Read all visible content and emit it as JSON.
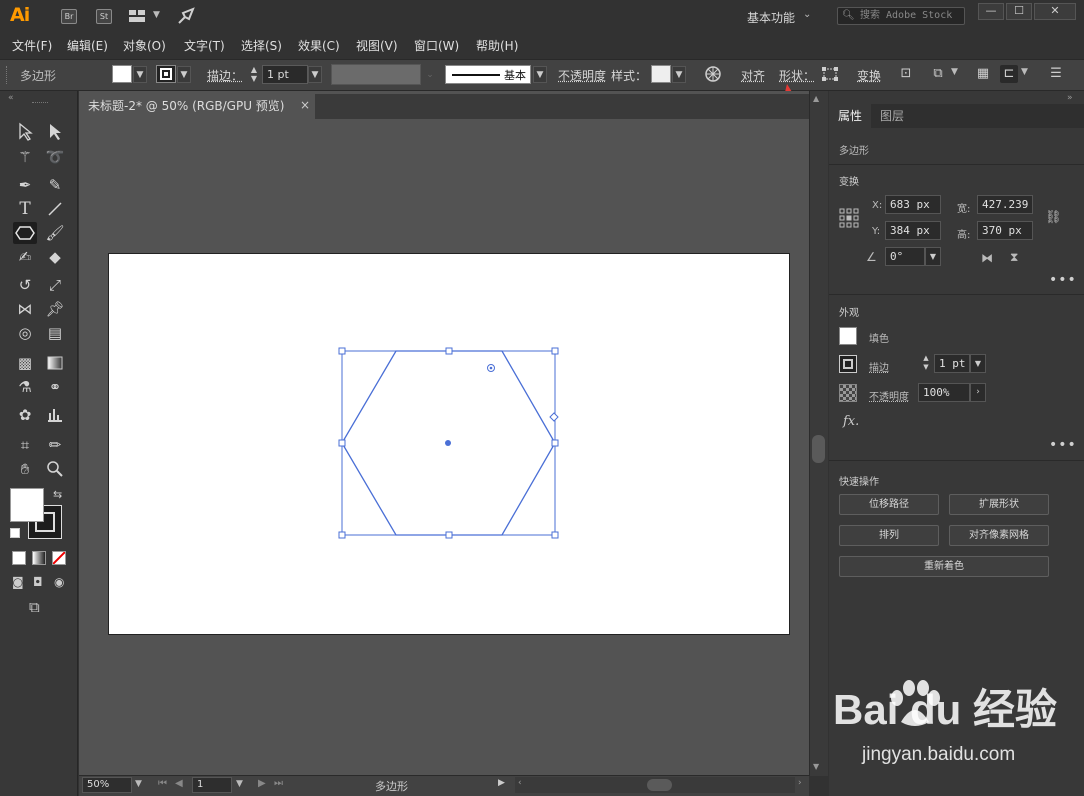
{
  "app": {
    "logo": "Ai",
    "br": "Br",
    "st": "St"
  },
  "titlebar": {
    "workspace": "基本功能",
    "search_placeholder": "搜索 Adobe Stock",
    "min": "—",
    "max": "☐",
    "close": "✕"
  },
  "menu": [
    "文件(F)",
    "编辑(E)",
    "对象(O)",
    "文字(T)",
    "选择(S)",
    "效果(C)",
    "视图(V)",
    "窗口(W)",
    "帮助(H)"
  ],
  "controlbar": {
    "object_type": "多边形",
    "stroke_label": "描边：",
    "stroke_value": "1 pt",
    "profile_label": "基本",
    "opacity_label": "不透明度",
    "style_label": "样式：",
    "align_label": "对齐",
    "shape_label": "形状：",
    "transform_label": "变换"
  },
  "document": {
    "tab_title": "未标题-2* @ 50% (RGB/GPU 预览)",
    "close": "×"
  },
  "statusbar": {
    "zoom": "50%",
    "page": "1",
    "tool_name": "多边形"
  },
  "properties": {
    "tabs": [
      "属性",
      "图层"
    ],
    "object_type": "多边形",
    "transform": {
      "title": "变换",
      "x_label": "X:",
      "x": "683 px",
      "y_label": "Y:",
      "y": "384 px",
      "w_label": "宽:",
      "w": "427.239",
      "h_label": "高:",
      "h": "370 px",
      "angle": "0°"
    },
    "appearance": {
      "title": "外观",
      "fill_label": "填色",
      "stroke_label": "描边",
      "stroke_value": "1 pt",
      "opacity_label": "不透明度",
      "opacity_value": "100%",
      "fx": "fx."
    },
    "quick_actions": {
      "title": "快速操作",
      "offset_path": "位移路径",
      "expand_shape": "扩展形状",
      "arrange": "排列",
      "align_pixel": "对齐像素网格",
      "recolor": "重新着色"
    }
  },
  "watermark": {
    "logo": "Bai du 经验",
    "url": "jingyan.baidu.com"
  },
  "colors": {
    "accent": "#4a6fd6",
    "arrow": "#e53935",
    "logo": "#ff9a00"
  }
}
